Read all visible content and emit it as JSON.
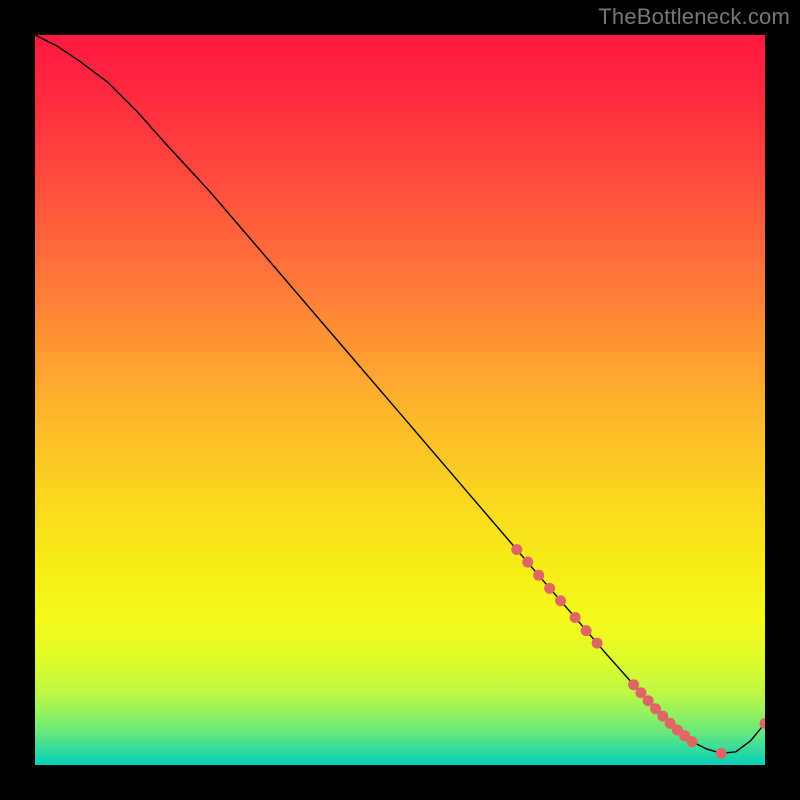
{
  "watermark": "TheBottleneck.com",
  "chart_data": {
    "type": "line",
    "title": "",
    "xlabel": "",
    "ylabel": "",
    "xlim": [
      0,
      100
    ],
    "ylim": [
      0,
      100
    ],
    "grid": false,
    "background": {
      "type": "vertical_gradient",
      "stops": [
        {
          "offset": 0.0,
          "color": "#ff193f"
        },
        {
          "offset": 0.07,
          "color": "#ff2740"
        },
        {
          "offset": 0.2,
          "color": "#ff4b3e"
        },
        {
          "offset": 0.35,
          "color": "#ff7c39"
        },
        {
          "offset": 0.5,
          "color": "#feb12d"
        },
        {
          "offset": 0.63,
          "color": "#fad61f"
        },
        {
          "offset": 0.73,
          "color": "#f7ed16"
        },
        {
          "offset": 0.8,
          "color": "#f5fa19"
        },
        {
          "offset": 0.86,
          "color": "#ddfb2c"
        },
        {
          "offset": 0.9,
          "color": "#bdf843"
        },
        {
          "offset": 0.93,
          "color": "#93f160"
        },
        {
          "offset": 0.955,
          "color": "#68e87d"
        },
        {
          "offset": 0.975,
          "color": "#3bdd99"
        },
        {
          "offset": 0.99,
          "color": "#1ad4ad"
        },
        {
          "offset": 1.0,
          "color": "#04ceba"
        }
      ]
    },
    "series": [
      {
        "name": "curve",
        "stroke": "#000000",
        "stroke_width": 1.4,
        "x": [
          0,
          3,
          6,
          10,
          14,
          18,
          24,
          30,
          36,
          42,
          48,
          54,
          60,
          66,
          70,
          74,
          78,
          82,
          84,
          86,
          88,
          90,
          92,
          94,
          96,
          98,
          100
        ],
        "y": [
          100,
          98.5,
          96.5,
          93.5,
          89.5,
          85,
          78.5,
          71.5,
          64.5,
          57.5,
          50.5,
          43.5,
          36.5,
          29.5,
          24.8,
          20.2,
          15.5,
          11,
          8.8,
          6.7,
          4.8,
          3.2,
          2.2,
          1.6,
          1.8,
          3.3,
          5.7
        ]
      }
    ],
    "markers": {
      "color": "#e06666",
      "radius": 5.5,
      "points": [
        {
          "x": 66.0,
          "y": 29.5
        },
        {
          "x": 67.5,
          "y": 27.8
        },
        {
          "x": 69.0,
          "y": 26.0
        },
        {
          "x": 70.5,
          "y": 24.2
        },
        {
          "x": 72.0,
          "y": 22.5
        },
        {
          "x": 74.0,
          "y": 20.2
        },
        {
          "x": 75.5,
          "y": 18.4
        },
        {
          "x": 77.0,
          "y": 16.7
        },
        {
          "x": 82.0,
          "y": 11.0
        },
        {
          "x": 83.0,
          "y": 9.9
        },
        {
          "x": 84.0,
          "y": 8.8
        },
        {
          "x": 85.0,
          "y": 7.7
        },
        {
          "x": 86.0,
          "y": 6.7
        },
        {
          "x": 87.0,
          "y": 5.7
        },
        {
          "x": 88.0,
          "y": 4.8
        },
        {
          "x": 89.0,
          "y": 4.0
        },
        {
          "x": 90.0,
          "y": 3.2
        },
        {
          "x": 94.0,
          "y": 1.6
        },
        {
          "x": 100.0,
          "y": 5.7
        }
      ]
    }
  }
}
